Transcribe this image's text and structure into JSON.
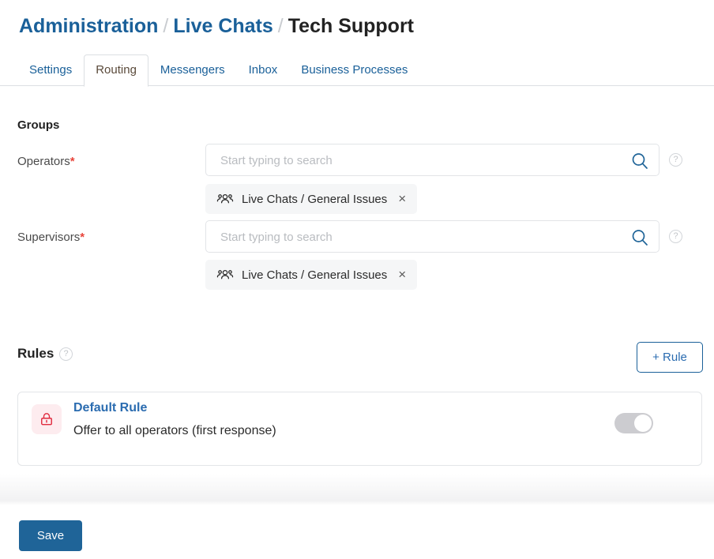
{
  "breadcrumb": {
    "items": [
      {
        "label": "Administration",
        "current": false
      },
      {
        "label": "Live Chats",
        "current": false
      },
      {
        "label": "Tech Support",
        "current": true
      }
    ],
    "separator": "/"
  },
  "tabs": [
    {
      "label": "Settings",
      "active": false
    },
    {
      "label": "Routing",
      "active": true
    },
    {
      "label": "Messengers",
      "active": false
    },
    {
      "label": "Inbox",
      "active": false
    },
    {
      "label": "Business Processes",
      "active": false
    }
  ],
  "groups": {
    "title": "Groups",
    "operators": {
      "label": "Operators",
      "required_marker": "*",
      "search_placeholder": "Start typing to search",
      "search_value": "",
      "search_icon": "search-icon",
      "help_icon": "?",
      "chips": [
        {
          "label": "Live Chats / General Issues",
          "icon": "people-group-icon",
          "close": "×"
        }
      ]
    },
    "supervisors": {
      "label": "Supervisors",
      "required_marker": "*",
      "search_placeholder": "Start typing to search",
      "search_value": "",
      "search_icon": "search-icon",
      "help_icon": "?",
      "chips": [
        {
          "label": "Live Chats / General Issues",
          "icon": "people-group-icon",
          "close": "×"
        }
      ]
    }
  },
  "rules": {
    "title": "Rules",
    "help_icon": "?",
    "add_button_label": "+ Rule",
    "items": [
      {
        "title": "Default Rule",
        "description": "Offer to all operators (first response)",
        "icon": "lock-icon",
        "toggle_on": false,
        "toggle_knob_position": "right"
      }
    ]
  },
  "footer": {
    "save_label": "Save"
  },
  "colors": {
    "link_blue": "#1a6099",
    "accent_blue": "#2b6cb0",
    "save_bg": "#1f6498",
    "required_red": "#e8443a",
    "lock_red": "#e02b3f",
    "lock_bg": "#fdecef",
    "chip_bg": "#f5f6f7",
    "toggle_off": "#ccccd0",
    "border": "#dcdfe3"
  }
}
